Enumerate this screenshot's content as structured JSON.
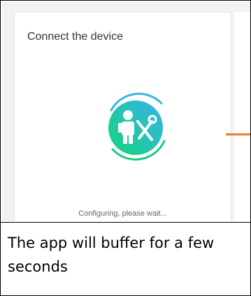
{
  "screen": {
    "title": "Connect the device",
    "status": "Configuring, please wait...",
    "icon": "technician-with-tools-icon",
    "spinner_colors": [
      "#1fc98e",
      "#2bb7e8"
    ],
    "accent_arrow_color": "#ed7d31"
  },
  "caption": {
    "text": "The app will buffer for a few seconds"
  }
}
